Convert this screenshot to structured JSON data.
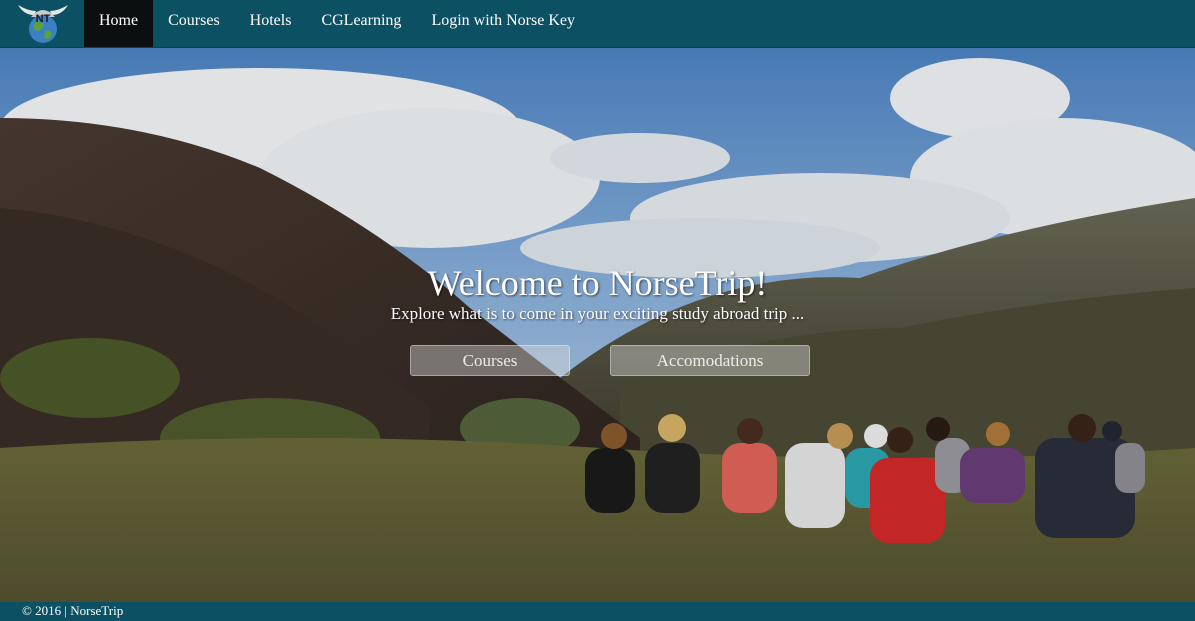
{
  "nav": {
    "logo_alt": "NT",
    "items": [
      {
        "label": "Home",
        "active": true
      },
      {
        "label": "Courses",
        "active": false
      },
      {
        "label": "Hotels",
        "active": false
      },
      {
        "label": "CGLearning",
        "active": false
      },
      {
        "label": "Login with Norse Key",
        "active": false
      }
    ]
  },
  "hero": {
    "title": "Welcome to NorseTrip!",
    "subtitle": "Explore what is to come in your exciting study abroad trip ...",
    "buttons": {
      "courses": "Courses",
      "accomodations": "Accomodations"
    }
  },
  "footer": {
    "text": "© 2016 | NorseTrip"
  },
  "colors": {
    "navbar": "#0c5163",
    "active_nav": "#0b0f10",
    "footer": "#0c5163"
  }
}
